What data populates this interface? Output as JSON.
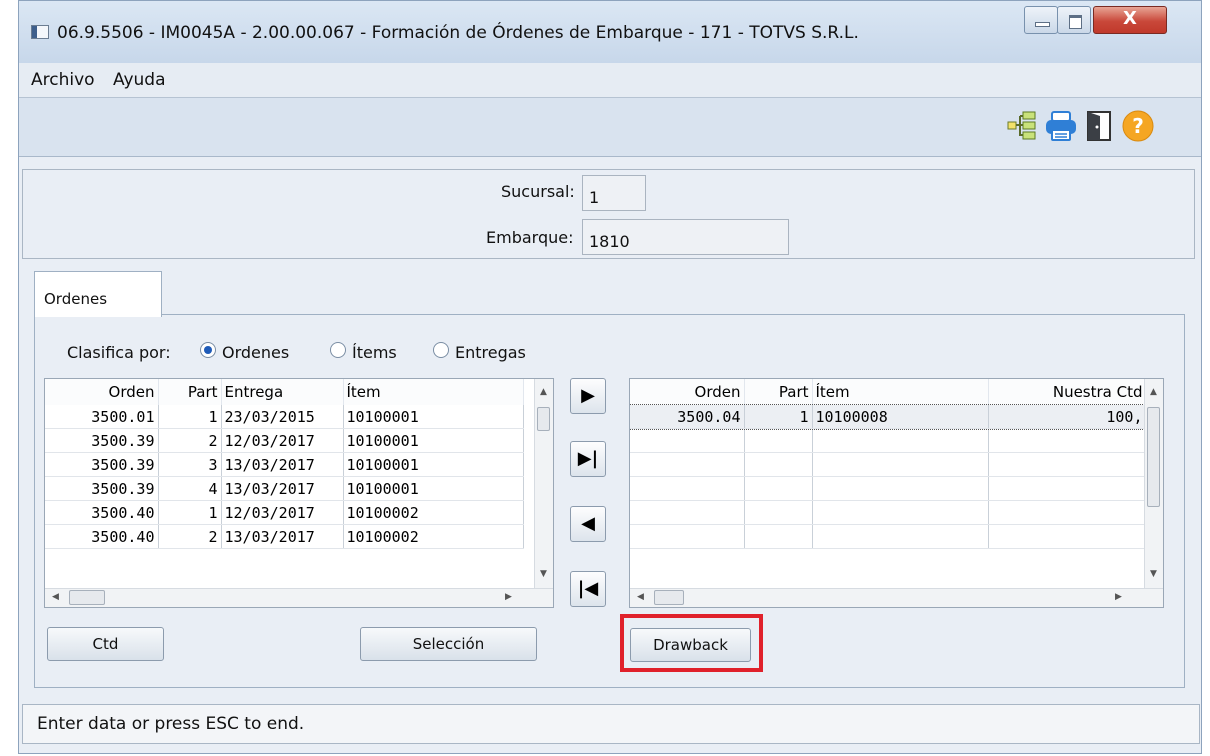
{
  "window": {
    "title": "06.9.5506 - IM0045A - 2.00.00.067 - Formación de Órdenes de Embarque - 171 - TOTVS S.R.L.",
    "close_glyph": "X"
  },
  "menu": {
    "items": [
      "Archivo",
      "Ayuda"
    ]
  },
  "toolbar": {
    "icons": [
      "tree-structure-icon",
      "print-icon",
      "exit-door-icon",
      "help-icon"
    ]
  },
  "form": {
    "sucursal_label": "Sucursal:",
    "sucursal_value": "1",
    "embarque_label": "Embarque:",
    "embarque_value": "1810"
  },
  "tab": {
    "label": "Ordenes"
  },
  "sort": {
    "label": "Clasifica por:",
    "options": [
      "Ordenes",
      "Ítems",
      "Entregas"
    ],
    "selected": "Ordenes"
  },
  "left_grid": {
    "columns": [
      "Orden",
      "Part",
      "Entrega",
      "Ítem"
    ],
    "rows": [
      [
        "3500.01",
        "1",
        "23/03/2015",
        "10100001"
      ],
      [
        "3500.39",
        "2",
        "12/03/2017",
        "10100001"
      ],
      [
        "3500.39",
        "3",
        "13/03/2017",
        "10100001"
      ],
      [
        "3500.39",
        "4",
        "13/03/2017",
        "10100001"
      ],
      [
        "3500.40",
        "1",
        "12/03/2017",
        "10100002"
      ],
      [
        "3500.40",
        "2",
        "13/03/2017",
        "10100002"
      ]
    ]
  },
  "right_grid": {
    "columns": [
      "Orden",
      "Part",
      "Ítem",
      "Nuestra Ctd"
    ],
    "rows": [
      [
        "3500.04",
        "1",
        "10100008",
        "100,"
      ]
    ]
  },
  "nav_buttons": [
    "▶",
    "▶|",
    "◀",
    "|◀"
  ],
  "buttons": {
    "ctd": "Ctd",
    "seleccion": "Selección",
    "drawback": "Drawback"
  },
  "status": {
    "text": "Enter data or press ESC to end."
  },
  "colors": {
    "highlight": "#e0212b",
    "help_icon": "#f5a623",
    "print_icon": "#2f7fd6"
  }
}
